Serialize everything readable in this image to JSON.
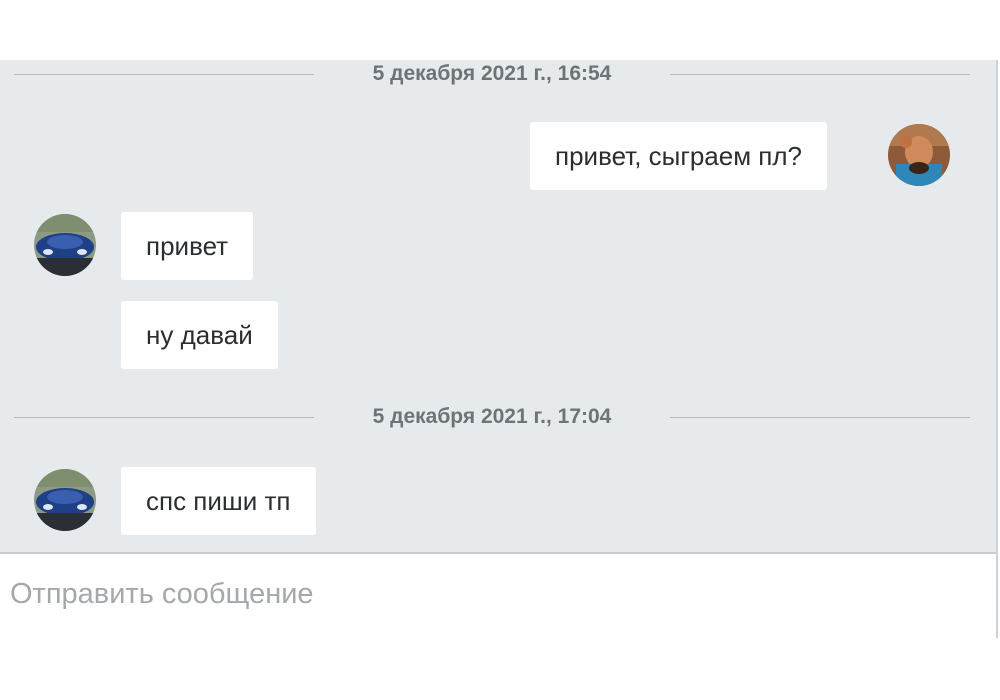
{
  "chat": {
    "messages": [
      {
        "kind": "divider",
        "date": "5 декабря 2021 г., 16:54"
      },
      {
        "kind": "outgoing",
        "text": "привет, сыграем пл?"
      },
      {
        "kind": "incoming",
        "text": "привет"
      },
      {
        "kind": "incoming",
        "text": "ну давай"
      },
      {
        "kind": "divider",
        "date": "5 декабря 2021 г., 17:04"
      },
      {
        "kind": "incoming",
        "text": "спс пиши тп"
      }
    ]
  },
  "composer": {
    "placeholder": "Отправить сообщение"
  },
  "avatars": {
    "self_photo_colors": [
      "#c86b3a",
      "#2f6f9c"
    ],
    "peer_photo_colors": [
      "#1d3d7a",
      "#7a8a70"
    ]
  }
}
